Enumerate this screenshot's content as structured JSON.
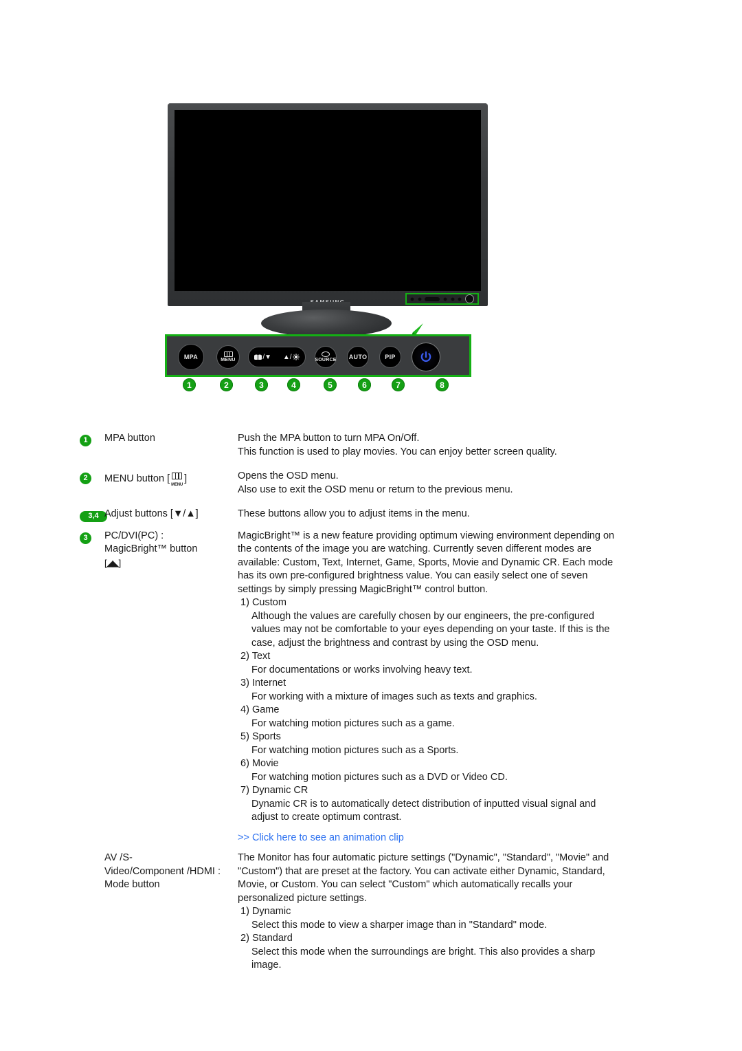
{
  "figure": {
    "brand": "SAMSUNG",
    "bezel_controls_name": "front-bezel-control-strip",
    "buttons": [
      {
        "marker": "1",
        "label": "MPA",
        "type": "text"
      },
      {
        "marker": "2",
        "label": "MENU",
        "type": "menu"
      },
      {
        "marker": "3",
        "label": "/▼",
        "type": "adjust-down"
      },
      {
        "marker": "4",
        "label": "▲/",
        "type": "adjust-up"
      },
      {
        "marker": "5",
        "label": "SOURCE",
        "type": "source"
      },
      {
        "marker": "6",
        "label": "AUTO",
        "type": "text"
      },
      {
        "marker": "7",
        "label": "PIP",
        "type": "text"
      },
      {
        "marker": "8",
        "label": "",
        "type": "power"
      }
    ],
    "markers": [
      "1",
      "2",
      "3",
      "4",
      "5",
      "6",
      "7",
      "8"
    ]
  },
  "colors": {
    "marker_green": "#14a014",
    "highlight_green": "#14b014",
    "link_blue": "#2a6ff0"
  },
  "rows": {
    "mpa": {
      "marker": "1",
      "name": "MPA button",
      "desc_line1": "Push the MPA button to turn MPA On/Off.",
      "desc_line2": "This function is used to play movies. You can enjoy better screen quality."
    },
    "menu": {
      "marker": "2",
      "name_prefix": "MENU button [",
      "name_suffix": "]",
      "icon_label": "MENU",
      "desc_line1": "Opens the OSD menu.",
      "desc_line2": "Also use to exit the OSD menu or return to the previous menu."
    },
    "adjust": {
      "marker": "3,4",
      "name": "Adjust buttons [▼/▲]",
      "desc_line1": "These buttons allow you to adjust items in the menu."
    },
    "magicbright": {
      "marker": "3",
      "name_line1": "PC/DVI(PC) :",
      "name_line2": "MagicBright™ button",
      "name_line3": "[◢◣]",
      "desc_paragraph": "MagicBright™ is a new feature providing optimum viewing environment depending on the contents of the image you are watching. Currently seven different modes are available: Custom, Text, Internet, Game, Sports, Movie and Dynamic CR. Each mode has its own pre-configured brightness value. You can easily select one of seven settings by simply pressing MagicBright™ control button.",
      "modes": [
        {
          "num": "1)",
          "title": "Custom",
          "body": "Although the values are carefully chosen by our engineers, the pre-configured values may not be comfortable to your eyes depending on your taste. If this is the case, adjust the brightness and contrast by using the OSD menu."
        },
        {
          "num": "2)",
          "title": "Text",
          "body": "For documentations or works involving heavy text."
        },
        {
          "num": "3)",
          "title": "Internet",
          "body": "For working with a mixture of images such as texts and graphics."
        },
        {
          "num": "4)",
          "title": "Game",
          "body": "For watching motion pictures such as a game."
        },
        {
          "num": "5)",
          "title": "Sports",
          "body": "For watching motion pictures such as a Sports."
        },
        {
          "num": "6)",
          "title": "Movie",
          "body": "For watching motion pictures such as a DVD or Video CD."
        },
        {
          "num": "7)",
          "title": "Dynamic CR",
          "body": "Dynamic CR is to automatically detect distribution of inputted visual signal and adjust to create optimum contrast."
        }
      ],
      "animation_link": ">> Click here to see an animation clip"
    },
    "mode": {
      "name_line1": "AV /S-",
      "name_line2": "Video/Component /HDMI :",
      "name_line3": "Mode button",
      "desc_paragraph": "The Monitor has four automatic picture settings (\"Dynamic\", \"Standard\", \"Movie\" and \"Custom\") that are preset at the factory. You can activate either Dynamic, Standard, Movie, or Custom. You can select \"Custom\" which automatically recalls your personalized picture settings.",
      "modes": [
        {
          "num": "1)",
          "title": "Dynamic",
          "body": "Select this mode to view a sharper image than in \"Standard\" mode."
        },
        {
          "num": "2)",
          "title": "Standard",
          "body": "Select this mode when the surroundings are bright. This also provides a sharp image."
        }
      ]
    }
  }
}
